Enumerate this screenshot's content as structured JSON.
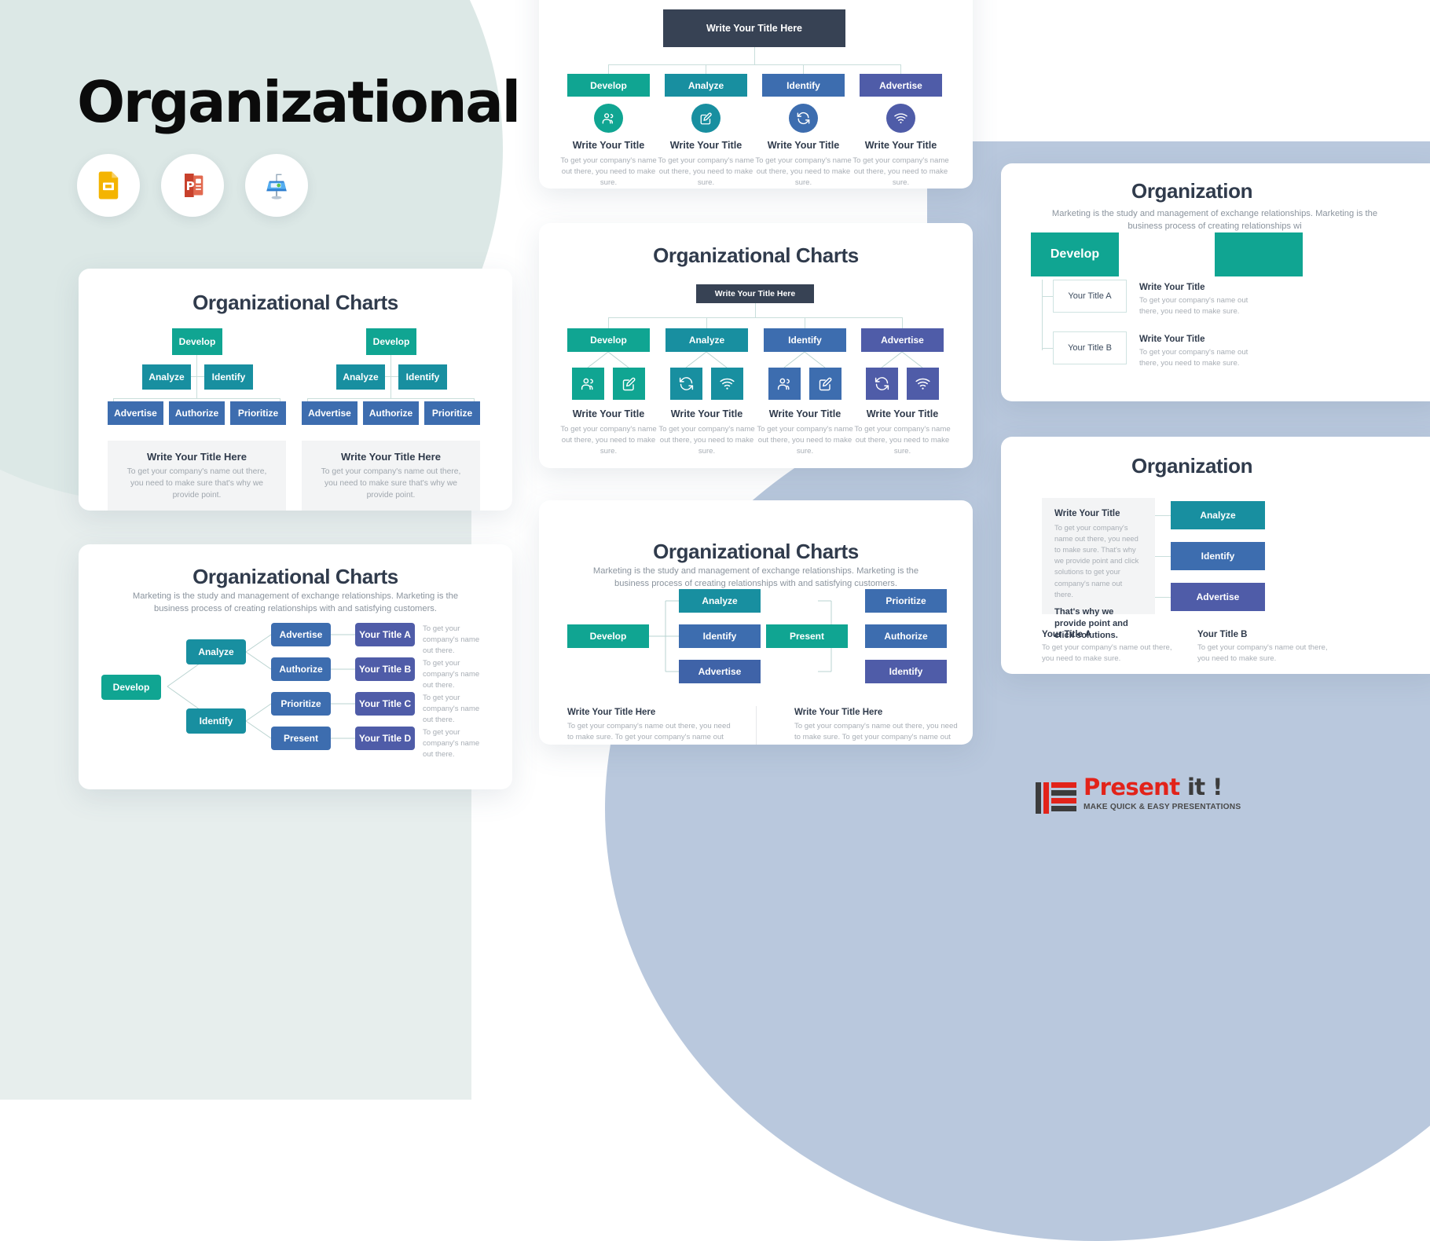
{
  "hero": {
    "title": "Organizational",
    "apps": [
      {
        "name": "google-slides",
        "label": "Google Slides"
      },
      {
        "name": "powerpoint",
        "label": "PowerPoint"
      },
      {
        "name": "keynote",
        "label": "Keynote"
      }
    ]
  },
  "common": {
    "chart_title": "Organizational Charts",
    "subtitle": "Marketing is the study and management of exchange relationships. Marketing is the business process of creating relationships with and satisfying customers.",
    "write_title_here": "Write Your Title Here",
    "write_title": "Write Your Title",
    "body_short": "To get your company's name out there, you need to make sure.",
    "body_mid": "To get your company's name out there, you need to make sure that's why we provide point.",
    "body_long": "To get your company's name out there, you need to make sure. To get your company's name out there."
  },
  "card_tree": {
    "title": "Organizational Charts",
    "trees": [
      {
        "root": "Develop",
        "level2": [
          "Analyze",
          "Identify"
        ],
        "level3": [
          "Advertise",
          "Authorize",
          "Prioritize"
        ],
        "caption_title": "Write Your Title Here",
        "caption_body": "To get your company's name out there, you need to make sure that's why we provide point."
      },
      {
        "root": "Develop",
        "level2": [
          "Analyze",
          "Identify"
        ],
        "level3": [
          "Advertise",
          "Authorize",
          "Prioritize"
        ],
        "caption_title": "Write Your Title Here",
        "caption_body": "To get your company's name out there, you need to make sure that's why we provide point."
      }
    ]
  },
  "card_horizontal": {
    "title": "Organizational Charts",
    "subtitle": "Marketing is the study and management of exchange relationships. Marketing is the business process of creating relationships with and satisfying customers.",
    "root": "Develop",
    "branches": [
      {
        "label": "Analyze",
        "children": [
          {
            "label": "Advertise",
            "title": "Your Title A",
            "body": "To get your company's name out there."
          },
          {
            "label": "Authorize",
            "title": "Your Title B",
            "body": "To get your company's name out there."
          }
        ]
      },
      {
        "label": "Identify",
        "children": [
          {
            "label": "Prioritize",
            "title": "Your Title C",
            "body": "To get your company's name out there."
          },
          {
            "label": "Present",
            "title": "Your Title D",
            "body": "To get your company's name out there."
          }
        ]
      }
    ]
  },
  "card_icons_top": {
    "root": "Write Your Title Here",
    "columns": [
      {
        "label": "Develop",
        "icon": "users-icon",
        "color": "#10a592",
        "title": "Write Your Title",
        "body": "To get your company's name out there, you need to make sure."
      },
      {
        "label": "Analyze",
        "icon": "edit-icon",
        "color": "#188fa0",
        "title": "Write Your Title",
        "body": "To get your company's name out there, you need to make sure."
      },
      {
        "label": "Identify",
        "icon": "sync-icon",
        "color": "#3d6daf",
        "title": "Write Your Title",
        "body": "To get your company's name out there, you need to make sure."
      },
      {
        "label": "Advertise",
        "icon": "wifi-icon",
        "color": "#4f5ca8",
        "title": "Write Your Title",
        "body": "To get your company's name out there, you need to make sure."
      }
    ]
  },
  "card_icons_mid": {
    "title": "Organizational Charts",
    "root": "Write Your Title Here",
    "columns": [
      {
        "label": "Develop",
        "color": "#10a592",
        "icons": [
          "users-icon",
          "edit-icon"
        ],
        "title": "Write Your Title",
        "body": "To get your company's name out there, you need to make sure."
      },
      {
        "label": "Analyze",
        "color": "#188fa0",
        "icons": [
          "sync-icon",
          "wifi-icon"
        ],
        "title": "Write Your Title",
        "body": "To get your company's name out there, you need to make sure."
      },
      {
        "label": "Identify",
        "color": "#3d6daf",
        "icons": [
          "users-icon",
          "edit-icon"
        ],
        "title": "Write Your Title",
        "body": "To get your company's name out there, you need to make sure."
      },
      {
        "label": "Advertise",
        "color": "#4f5ca8",
        "icons": [
          "sync-icon",
          "wifi-icon"
        ],
        "title": "Write Your Title",
        "body": "To get your company's name out there, you need to make sure."
      }
    ]
  },
  "card_two_groups": {
    "title": "Organizational Charts",
    "subtitle": "Marketing is the study and management of exchange relationships. Marketing is the business process of creating relationships with and satisfying customers.",
    "groups": [
      {
        "root": "Develop",
        "children": [
          "Analyze",
          "Identify",
          "Advertise"
        ],
        "caption_title": "Write Your Title Here",
        "caption_body": "To get your company's name out there, you need to make sure. To get your company's name out there."
      },
      {
        "root": "Present",
        "children": [
          "Prioritize",
          "Authorize",
          "Identify"
        ],
        "caption_title": "Write Your Title Here",
        "caption_body": "To get your company's name out there, you need to make sure. To get your company's name out there."
      }
    ]
  },
  "card_right_top": {
    "title": "Organization",
    "subtitle": "Marketing is the study and management of exchange relationships. Marketing is the business process of creating relationships wi",
    "root": "Develop",
    "items": [
      {
        "label": "Your Title A",
        "title": "Write Your Title",
        "body": "To get your company's name out there, you need to make sure."
      },
      {
        "label": "Your Title B",
        "title": "Write Your Title",
        "body": "To get your company's name out there, you need to make sure."
      }
    ]
  },
  "card_right_bottom": {
    "title": "Organization",
    "panel": {
      "title": "Write Your Title",
      "body": "To get your company's name out there, you need to make sure. That's why we provide point and click solutions to get your company's name out there.",
      "highlight": "That's why we provide point and click solutions."
    },
    "nodes": [
      "Analyze",
      "Identify",
      "Advertise"
    ],
    "footers": [
      {
        "title": "Your Title A",
        "body": "To get your company's name out there, you need to make sure."
      },
      {
        "title": "Your Title B",
        "body": "To get your company's name out there, you need to make sure."
      }
    ]
  },
  "logo": {
    "word_present": "Present",
    "word_it": "it !",
    "tagline": "MAKE QUICK & EASY PRESENTATIONS"
  }
}
